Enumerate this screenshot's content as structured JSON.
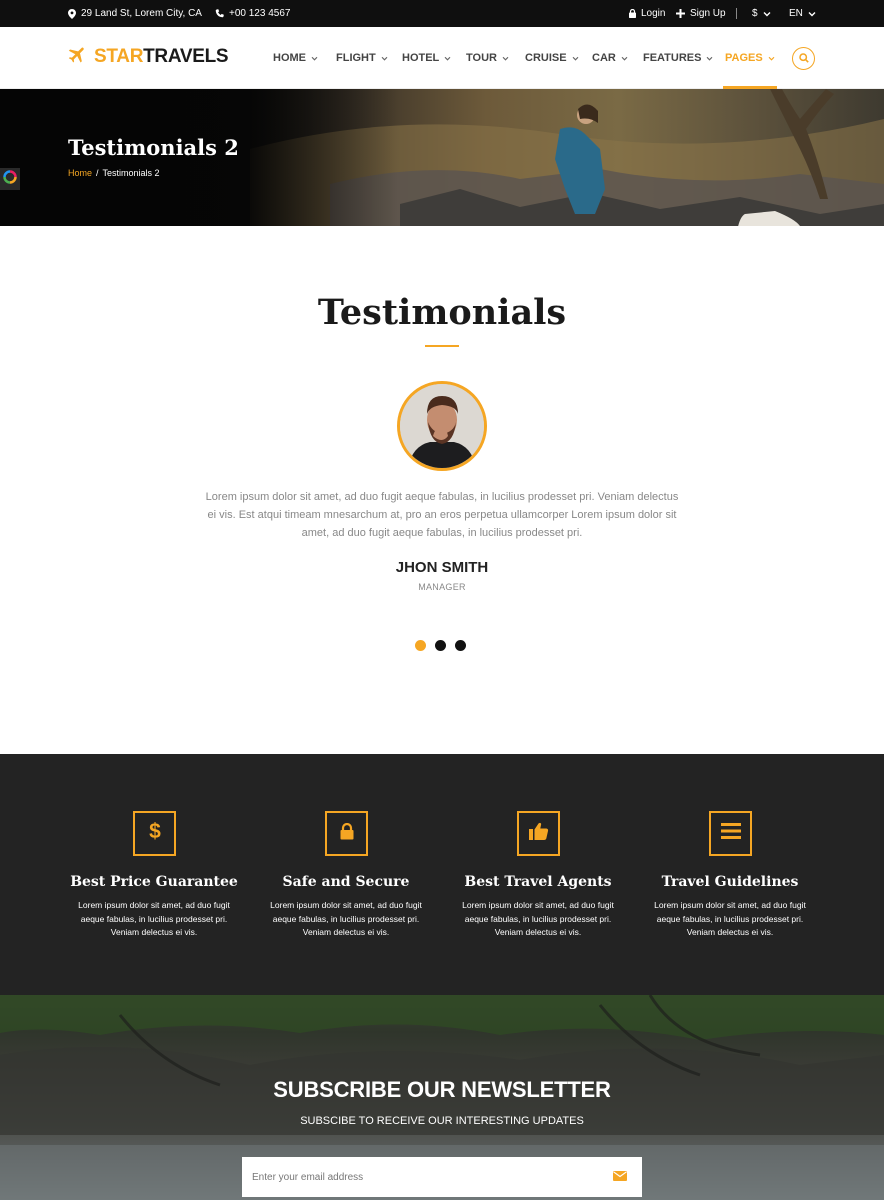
{
  "topbar": {
    "address": "29 Land St, Lorem City, CA",
    "phone": "+00 123 4567",
    "login": "Login",
    "signup": "Sign Up",
    "currency": "$",
    "language": "EN"
  },
  "header": {
    "logo_part1": "STAR",
    "logo_part2": "TRAVELS",
    "nav": [
      {
        "label": "HOME"
      },
      {
        "label": "FLIGHT"
      },
      {
        "label": "HOTEL"
      },
      {
        "label": "TOUR"
      },
      {
        "label": "CRUISE"
      },
      {
        "label": "CAR"
      },
      {
        "label": "FEATURES"
      },
      {
        "label": "PAGES",
        "active": true
      }
    ]
  },
  "hero": {
    "title": "Testimonials 2",
    "breadcrumb_home": "Home",
    "breadcrumb_sep": "/",
    "breadcrumb_current": "Testimonials 2"
  },
  "testimonials": {
    "title": "Testimonials",
    "quote": "Lorem ipsum dolor sit amet, ad duo fugit aeque fabulas, in lucilius prodesset pri. Veniam delectus ei vis. Est atqui timeam mnesarchum at, pro an eros perpetua ullamcorper Lorem ipsum dolor sit amet, ad duo fugit aeque fabulas, in lucilius prodesset pri.",
    "name": "JHON SMITH",
    "role": "MANAGER",
    "slide_count": 3,
    "active_slide": 1
  },
  "features": [
    {
      "icon": "dollar-icon",
      "title": "Best Price Guarantee",
      "desc": "Lorem ipsum dolor sit amet, ad duo fugit aeque fabulas, in lucilius prodesset pri. Veniam delectus ei vis."
    },
    {
      "icon": "lock-icon",
      "title": "Safe and Secure",
      "desc": "Lorem ipsum dolor sit amet, ad duo fugit aeque fabulas, in lucilius prodesset pri. Veniam delectus ei vis."
    },
    {
      "icon": "thumbs-up-icon",
      "title": "Best Travel Agents",
      "desc": "Lorem ipsum dolor sit amet, ad duo fugit aeque fabulas, in lucilius prodesset pri. Veniam delectus ei vis."
    },
    {
      "icon": "list-icon",
      "title": "Travel Guidelines",
      "desc": "Lorem ipsum dolor sit amet, ad duo fugit aeque fabulas, in lucilius prodesset pri. Veniam delectus ei vis."
    }
  ],
  "newsletter": {
    "title": "SUBSCRIBE OUR NEWSLETTER",
    "subtitle": "SUBSCIBE TO RECEIVE OUR INTERESTING UPDATES",
    "placeholder": "Enter your email address"
  },
  "colors": {
    "accent": "#f5a623",
    "topbar_bg": "#0f0f0f",
    "features_bg": "#232323"
  }
}
